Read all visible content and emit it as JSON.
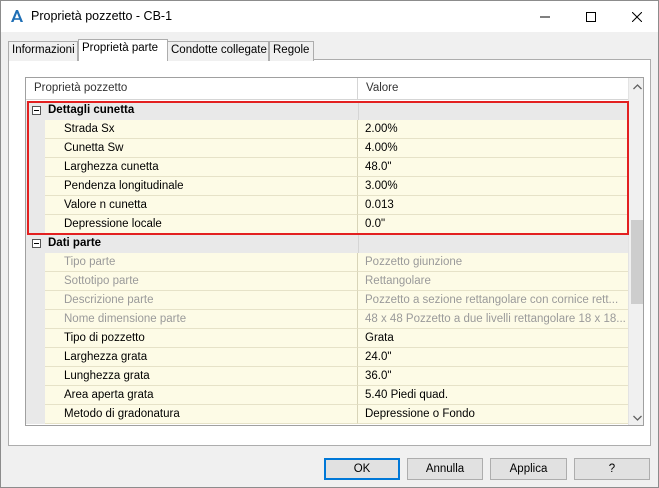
{
  "window": {
    "title": "Proprietà pozzetto - CB-1"
  },
  "tabs": [
    {
      "label": "Informazioni"
    },
    {
      "label": "Proprietà parte"
    },
    {
      "label": "Condotte collegate"
    },
    {
      "label": "Regole"
    }
  ],
  "grid": {
    "col_property": "Proprietà pozzetto",
    "col_value": "Valore",
    "categories": [
      {
        "label": "Dettagli cunetta",
        "rows": [
          {
            "name": "Strada Sx",
            "value": "2.00%"
          },
          {
            "name": "Cunetta Sw",
            "value": "4.00%"
          },
          {
            "name": "Larghezza cunetta",
            "value": "48.0\""
          },
          {
            "name": "Pendenza longitudinale",
            "value": "3.00%"
          },
          {
            "name": "Valore n cunetta",
            "value": "0.013"
          },
          {
            "name": "Depressione locale",
            "value": "0.0\""
          }
        ]
      },
      {
        "label": "Dati parte",
        "rows": [
          {
            "name": "Tipo parte",
            "value": "Pozzetto giunzione"
          },
          {
            "name": "Sottotipo parte",
            "value": "Rettangolare"
          },
          {
            "name": "Descrizione parte",
            "value": "Pozzetto a sezione rettangolare con cornice rett..."
          },
          {
            "name": "Nome dimensione parte",
            "value": "48 x 48 Pozzetto a due livelli rettangolare 18 x 18..."
          },
          {
            "name": "Tipo di pozzetto",
            "value": "Grata"
          },
          {
            "name": "Larghezza grata",
            "value": "24.0\""
          },
          {
            "name": "Lunghezza grata",
            "value": "36.0\""
          },
          {
            "name": "Area aperta grata",
            "value": "5.40 Piedi quad."
          },
          {
            "name": "Metodo di gradonatura",
            "value": "Depressione o Fondo"
          }
        ]
      }
    ]
  },
  "buttons": {
    "ok": "OK",
    "cancel": "Annulla",
    "apply": "Applica",
    "help": "?"
  },
  "colors": {
    "highlight": "#e32020",
    "cell_background": "#fdfbe6",
    "accent": "#0078d7"
  }
}
